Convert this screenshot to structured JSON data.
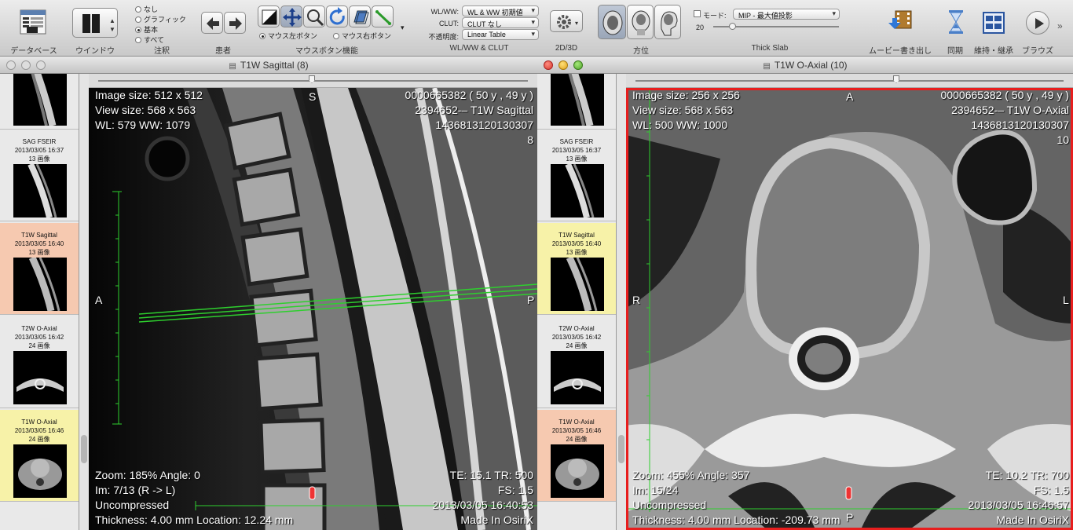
{
  "toolbar": {
    "database_label": "データベース",
    "window_label": "ウインドウ",
    "annotations": {
      "label": "注釈",
      "options": [
        "なし",
        "グラフィック",
        "基本",
        "すべて"
      ],
      "selected": "基本"
    },
    "patient_label": "患者",
    "mouse": {
      "label": "マウスボタン機能",
      "left": "マウス左ボタン",
      "right": "マウス右ボタン"
    },
    "wlclut": {
      "label": "WL/WW & CLUT",
      "wlww_label": "WL/WW:",
      "wlww_value": "WL & WW 初期値",
      "clut_label": "CLUT:",
      "clut_value": "CLUT なし",
      "opacity_label": "不透明度:",
      "opacity_value": "Linear Table"
    },
    "view2d3d_label": "2D/3D",
    "orientation_label": "方位",
    "thick_slab": {
      "label": "Thick Slab",
      "mode_label": "モード:",
      "mode_value": "MIP - 最大値投影",
      "value": "20"
    },
    "movie_label": "ムービー書き出し",
    "sync_label": "同期",
    "tile_label": "維持・継承",
    "browse_label": "ブラウズ"
  },
  "left_window": {
    "title": "T1W Sagittal (8)",
    "series": [
      {
        "name": "SAG FSEIR",
        "date": "2013/03/05 16:37",
        "count": "13 画像",
        "state": "normal"
      },
      {
        "name": "T1W Sagittal",
        "date": "2013/03/05 16:40",
        "count": "13 画像",
        "state": "active"
      },
      {
        "name": "T2W O-Axial",
        "date": "2013/03/05 16:42",
        "count": "24 画像",
        "state": "normal"
      },
      {
        "name": "T1W O-Axial",
        "date": "2013/03/05 16:46",
        "count": "24 画像",
        "state": "related"
      }
    ],
    "overlay": {
      "image_size": "Image size: 512 x 512",
      "view_size": "View size: 568 x 563",
      "wl": "WL: 579 WW: 1079",
      "patient_id": "0000665382 ( 50 y , 49 y )",
      "study": "2394652-– T1W Sagittal",
      "uid": "1436813120130307",
      "series_no": "8",
      "top_marker": "S",
      "left_marker": "A",
      "right_marker": "P",
      "zoom": "Zoom: 185% Angle: 0",
      "im": "Im: 7/13  (R -> L)",
      "compression": "Uncompressed",
      "thickness": "Thickness: 4.00 mm Location: 12.24 mm",
      "te_tr": "TE:  15.1 TR:  500",
      "fs": "FS:  1.5",
      "datetime": "2013/03/05 16:40:53",
      "made_in": "Made In OsiriX"
    }
  },
  "right_window": {
    "title": "T1W O-Axial (10)",
    "series": [
      {
        "name": "SAG FSEIR",
        "date": "2013/03/05 16:37",
        "count": "13 画像",
        "state": "normal"
      },
      {
        "name": "T1W Sagittal",
        "date": "2013/03/05 16:40",
        "count": "13 画像",
        "state": "related"
      },
      {
        "name": "T2W O-Axial",
        "date": "2013/03/05 16:42",
        "count": "24 画像",
        "state": "normal"
      },
      {
        "name": "T1W O-Axial",
        "date": "2013/03/05 16:46",
        "count": "24 画像",
        "state": "active"
      }
    ],
    "overlay": {
      "image_size": "Image size: 256 x 256",
      "view_size": "View size: 568 x 563",
      "wl": "WL: 500 WW: 1000",
      "patient_id": "0000665382 ( 50 y , 49 y )",
      "study": "2394652-– T1W O-Axial",
      "uid": "1436813120130307",
      "series_no": "10",
      "top_marker": "A",
      "left_marker": "R",
      "right_marker": "L",
      "bottom_marker": "P",
      "zoom": "Zoom: 455% Angle: 357",
      "im": "Im: 15/24",
      "compression": "Uncompressed",
      "thickness": "Thickness: 4.00 mm Location: -209.73 mm",
      "te_tr": "TE:  10.2 TR:  700",
      "fs": "FS:  1.5",
      "datetime": "2013/03/05 16:46:57",
      "made_in": "Made In OsiriX"
    }
  },
  "colors": {
    "active": "#f6c9b0",
    "related": "#f7f2a8",
    "selection": "#e81e1e",
    "crossline": "#2ecf2e"
  }
}
